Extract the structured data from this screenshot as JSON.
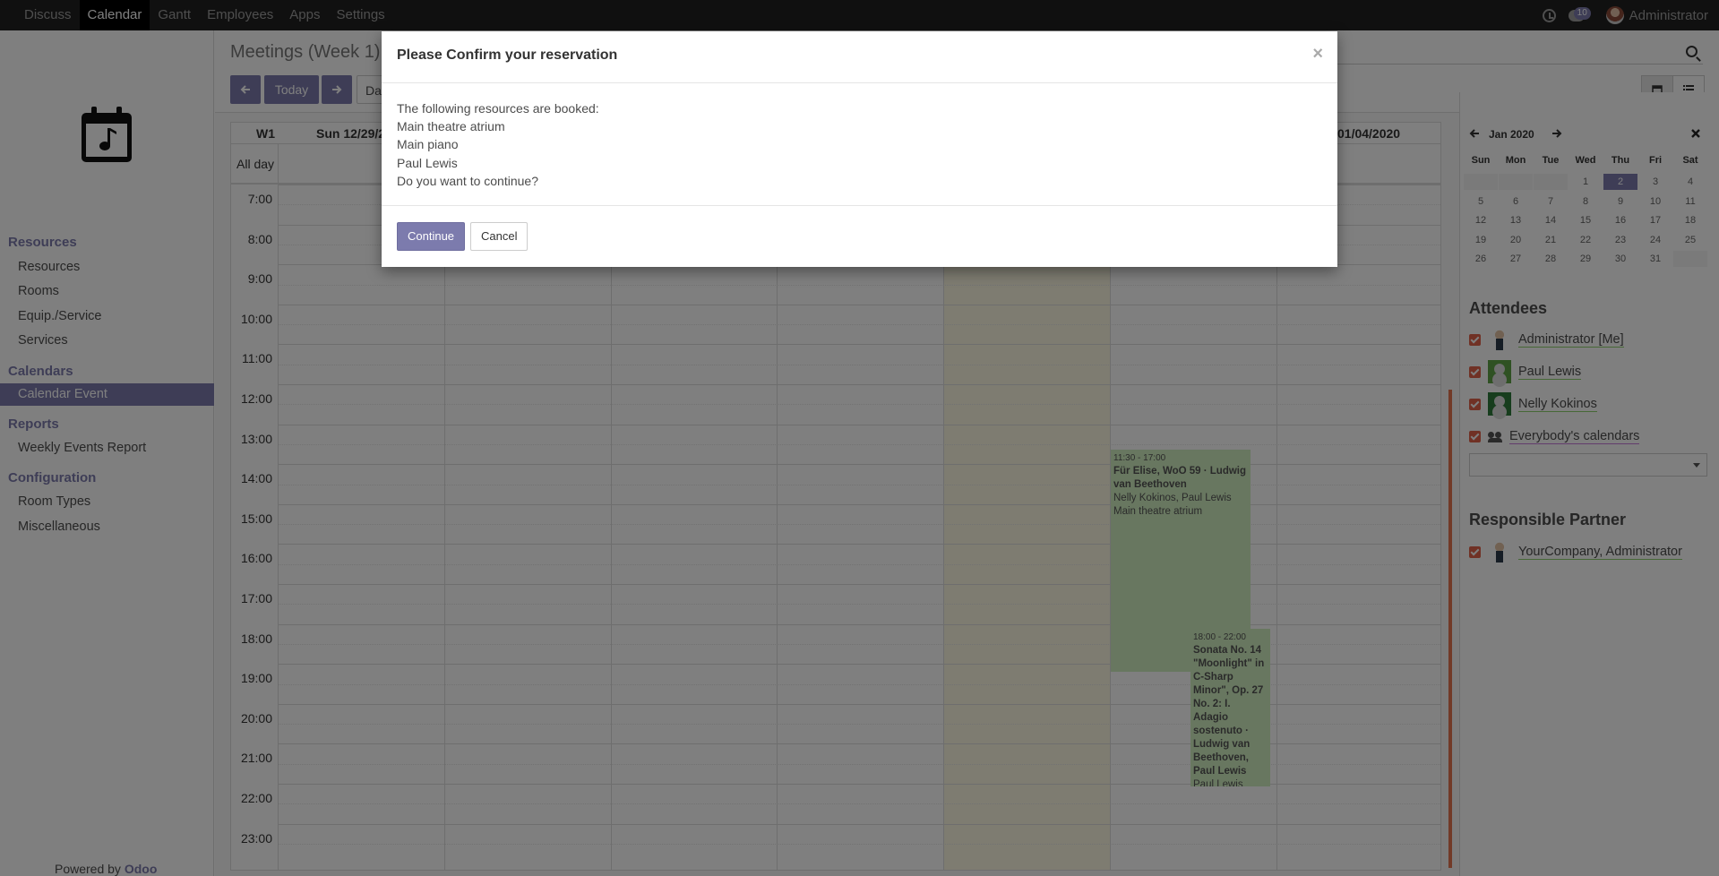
{
  "navbar": {
    "items": [
      "Discuss",
      "Calendar",
      "Gantt",
      "Employees",
      "Apps",
      "Settings"
    ],
    "active_index": 1,
    "chat_badge": "10",
    "user": "Administrator"
  },
  "sidebar": {
    "sections": [
      {
        "title": "Resources",
        "items": [
          "Resources",
          "Rooms",
          "Equip./Service",
          "Services"
        ]
      },
      {
        "title": "Calendars",
        "items": [
          "Calendar Event"
        ]
      },
      {
        "title": "Reports",
        "items": [
          "Weekly Events Report"
        ]
      },
      {
        "title": "Configuration",
        "items": [
          "Room Types",
          "Miscellaneous"
        ]
      }
    ],
    "powered_prefix": "Powered by",
    "powered_brand": "Odoo"
  },
  "control_panel": {
    "breadcrumb": "Meetings (Week 1)",
    "today_label": "Today",
    "day_label_fragment": "Da"
  },
  "calendar": {
    "week_label": "W1",
    "first_day_fragment": "Sun 12/29/2",
    "last_day_fragment": "01/04/2020",
    "allday_label": "All day",
    "hours": [
      "7:00",
      "8:00",
      "9:00",
      "10:00",
      "11:00",
      "12:00",
      "13:00",
      "14:00",
      "15:00",
      "16:00",
      "17:00",
      "18:00",
      "19:00",
      "20:00",
      "21:00",
      "22:00",
      "23:00"
    ],
    "events": [
      {
        "time": "11:30 - 17:00",
        "title": "Für Elise, WoO 59 · Ludwig van Beethoven",
        "line1": "Nelly Kokinos, Paul Lewis",
        "line2": "Main theatre atrium"
      },
      {
        "time": "18:00 - 22:00",
        "title": "Sonata No. 14 \"Moonlight\" in C-Sharp Minor\", Op. 27 No. 2: I. Adagio sostenuto · Ludwig van Beethoven, Paul Lewis",
        "line1": "Paul Lewis"
      }
    ],
    "colors": {
      "event_bg": "#d1efc0",
      "today_bg": "#fcf8e3",
      "now_bar": "#e57550"
    }
  },
  "mini_calendar": {
    "title": "Jan 2020",
    "dow": [
      "Sun",
      "Mon",
      "Tue",
      "Wed",
      "Thu",
      "Fri",
      "Sat"
    ],
    "rows": [
      [
        "",
        "",
        "",
        "1",
        "2",
        "3",
        "4"
      ],
      [
        "5",
        "6",
        "7",
        "8",
        "9",
        "10",
        "11"
      ],
      [
        "12",
        "13",
        "14",
        "15",
        "16",
        "17",
        "18"
      ],
      [
        "19",
        "20",
        "21",
        "22",
        "23",
        "24",
        "25"
      ],
      [
        "26",
        "27",
        "28",
        "29",
        "30",
        "31",
        ""
      ]
    ],
    "selected": "2"
  },
  "attendees": {
    "title": "Attendees",
    "items": [
      "Administrator [Me]",
      "Paul Lewis",
      "Nelly Kokinos",
      "Everybody's calendars"
    ]
  },
  "responsible": {
    "title": "Responsible Partner",
    "items": [
      "YourCompany, Administrator"
    ]
  },
  "modal": {
    "title": "Please Confirm your reservation",
    "close": "×",
    "intro": "The following resources are booked:",
    "resources": [
      "Main theatre atrium",
      "Main piano",
      "Paul Lewis"
    ],
    "question": "Do you want to continue?",
    "continue_label": "Continue",
    "cancel_label": "Cancel"
  },
  "colors": {
    "accent": "#7c7bad",
    "checkbox": "#e0634b"
  }
}
